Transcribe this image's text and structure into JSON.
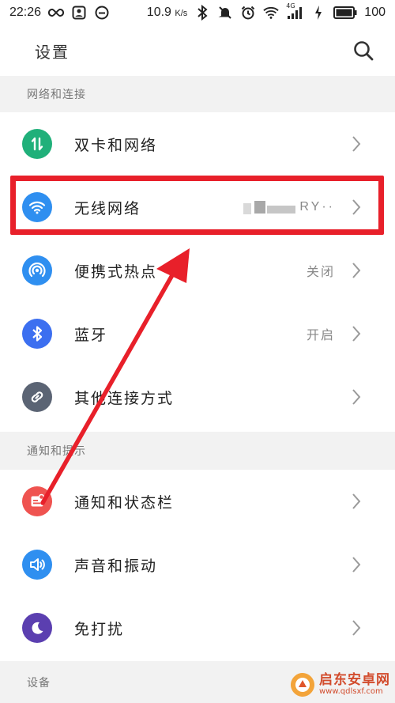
{
  "status_bar": {
    "time": "22:26",
    "speed": "10.9",
    "speed_unit": "K/s",
    "network_tag": "4G",
    "battery": "100"
  },
  "header": {
    "title": "设置"
  },
  "sections": {
    "network": "网络和连接",
    "notify": "通知和提示",
    "device": "设备"
  },
  "rows": {
    "dual_sim": {
      "label": "双卡和网络",
      "icon": "dual-sim-icon",
      "color": "#20b07a"
    },
    "wifi": {
      "label": "无线网络",
      "value_visible": "RY··",
      "icon": "wifi-icon",
      "color": "#2f8ff0"
    },
    "hotspot": {
      "label": "便携式热点",
      "value": "关闭",
      "icon": "hotspot-icon",
      "color": "#2f8ff0"
    },
    "bluetooth": {
      "label": "蓝牙",
      "value": "开启",
      "icon": "bluetooth-icon",
      "color": "#3c6ff0"
    },
    "other_conn": {
      "label": "其他连接方式",
      "icon": "link-icon",
      "color": "#5b6474"
    },
    "notification": {
      "label": "通知和状态栏",
      "icon": "notification-icon",
      "color": "#ef5350"
    },
    "sound": {
      "label": "声音和振动",
      "icon": "speaker-icon",
      "color": "#2f8ff0"
    },
    "dnd": {
      "label": "免打扰",
      "icon": "moon-icon",
      "color": "#5b3fb0"
    }
  },
  "watermark": {
    "main": "启东安卓网",
    "sub": "www.qdlsxf.com"
  },
  "annotation": {
    "color": "#e8202a"
  }
}
